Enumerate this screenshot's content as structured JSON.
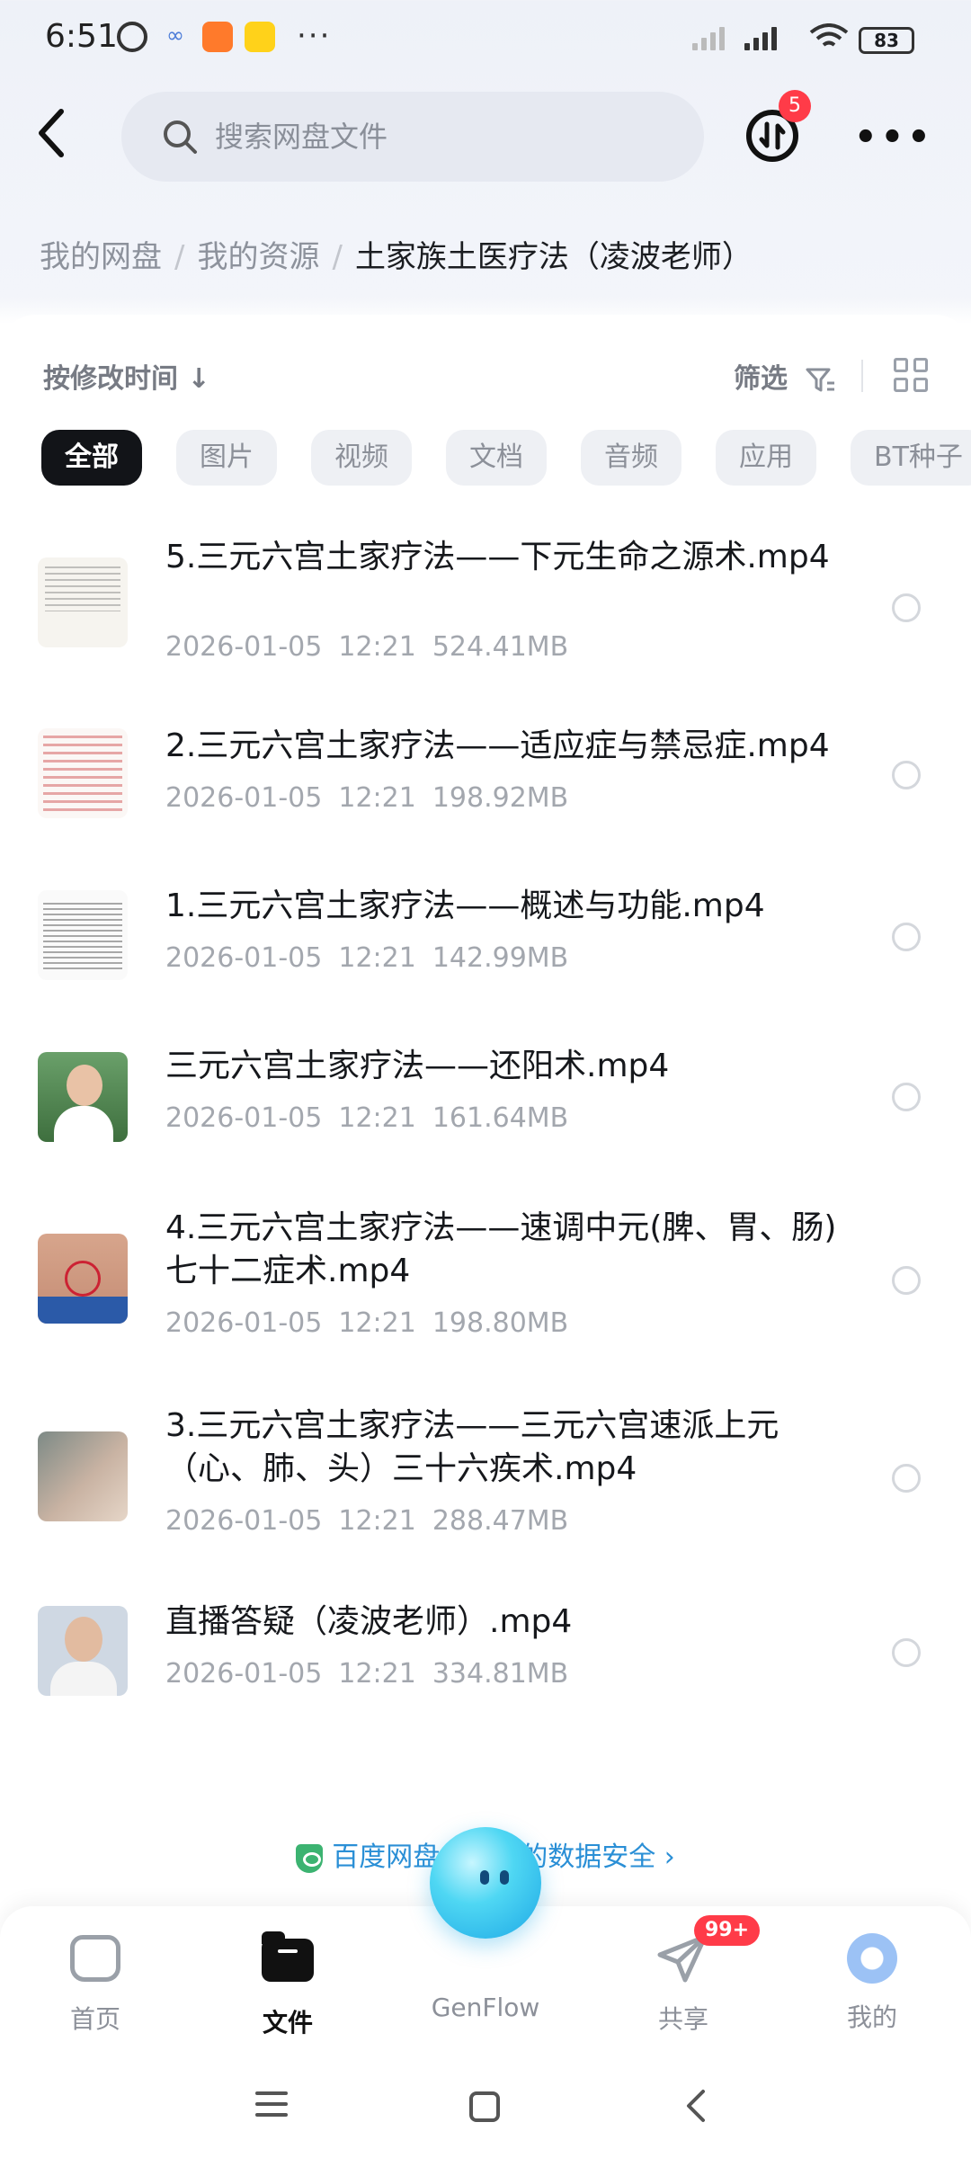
{
  "status_bar": {
    "time": "6:51",
    "more_dots": "···",
    "battery": "83"
  },
  "header": {
    "search_placeholder": "搜索网盘文件",
    "transfer_badge": "5",
    "more_label": "•••"
  },
  "breadcrumb": [
    {
      "label": "我的网盘"
    },
    {
      "label": "我的资源"
    },
    {
      "label": "土家族土医疗法（凌波老师）"
    }
  ],
  "toolbar": {
    "sort_label": "按修改时间 ↓",
    "filter_label": "筛选"
  },
  "tabs": [
    {
      "label": "全部",
      "active": true
    },
    {
      "label": "图片",
      "active": false
    },
    {
      "label": "视频",
      "active": false
    },
    {
      "label": "文档",
      "active": false
    },
    {
      "label": "音频",
      "active": false
    },
    {
      "label": "应用",
      "active": false
    },
    {
      "label": "BT种子",
      "active": false
    }
  ],
  "files": [
    {
      "name": "5.三元六宫土家疗法——下元生命之源术.mp4",
      "date": "2026-01-05",
      "time": "12:21",
      "size": "524.41MB",
      "thumb": "document"
    },
    {
      "name": "2.三元六宫土家疗法——适应症与禁忌症.mp4",
      "date": "2026-01-05",
      "time": "12:21",
      "size": "198.92MB",
      "thumb": "document-red"
    },
    {
      "name": "1.三元六宫土家疗法——概述与功能.mp4",
      "date": "2026-01-05",
      "time": "12:21",
      "size": "142.99MB",
      "thumb": "document-text"
    },
    {
      "name": "三元六宫土家疗法——还阳术.mp4",
      "date": "2026-01-05",
      "time": "12:21",
      "size": "161.64MB",
      "thumb": "person"
    },
    {
      "name": "4.三元六宫土家疗法——速调中元(脾、胃、肠)七十二症术.mp4",
      "date": "2026-01-05",
      "time": "12:21",
      "size": "198.80MB",
      "thumb": "abdomen"
    },
    {
      "name": "3.三元六宫土家疗法——三元六宫速派上元（心、肺、头）三十六疾术.mp4",
      "date": "2026-01-05",
      "time": "12:21",
      "size": "288.47MB",
      "thumb": "back"
    },
    {
      "name": "直播答疑（凌波老师）.mp4",
      "date": "2026-01-05",
      "time": "12:21",
      "size": "334.81MB",
      "thumb": "host"
    }
  ],
  "security_banner": "百度网盘保障你的数据安全 ›",
  "bottom_nav": {
    "home": "首页",
    "files": "文件",
    "genflow": "GenFlow",
    "share": "共享",
    "share_badge": "99+",
    "me": "我的"
  }
}
